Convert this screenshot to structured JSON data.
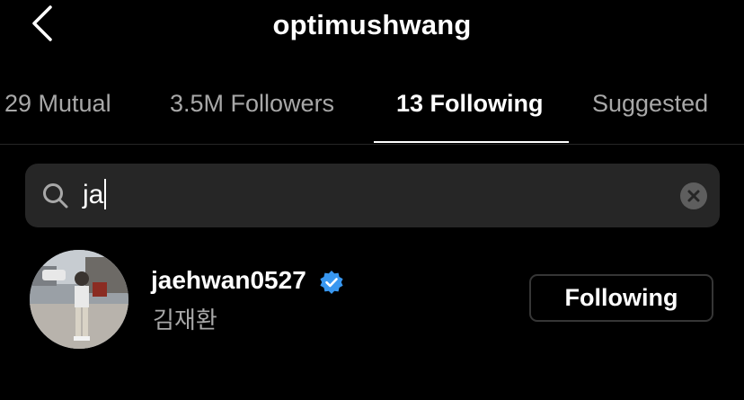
{
  "header": {
    "back_icon": "chevron-left-icon",
    "title": "optimushwang"
  },
  "tabs": [
    {
      "label": "29 Mutual",
      "active": false
    },
    {
      "label": "3.5M Followers",
      "active": false
    },
    {
      "label": "13 Following",
      "active": true
    },
    {
      "label": "Suggested",
      "active": false
    }
  ],
  "search": {
    "icon": "search-icon",
    "value": "ja",
    "clear_icon": "clear-icon"
  },
  "results": [
    {
      "username": "jaehwan0527",
      "verified": true,
      "full_name": "김재환",
      "button_label": "Following"
    }
  ],
  "colors": {
    "background": "#000000",
    "secondary_text": "#a8a8a8",
    "search_bg": "#262626",
    "verified_blue": "#3897f0",
    "button_border": "#363636"
  }
}
